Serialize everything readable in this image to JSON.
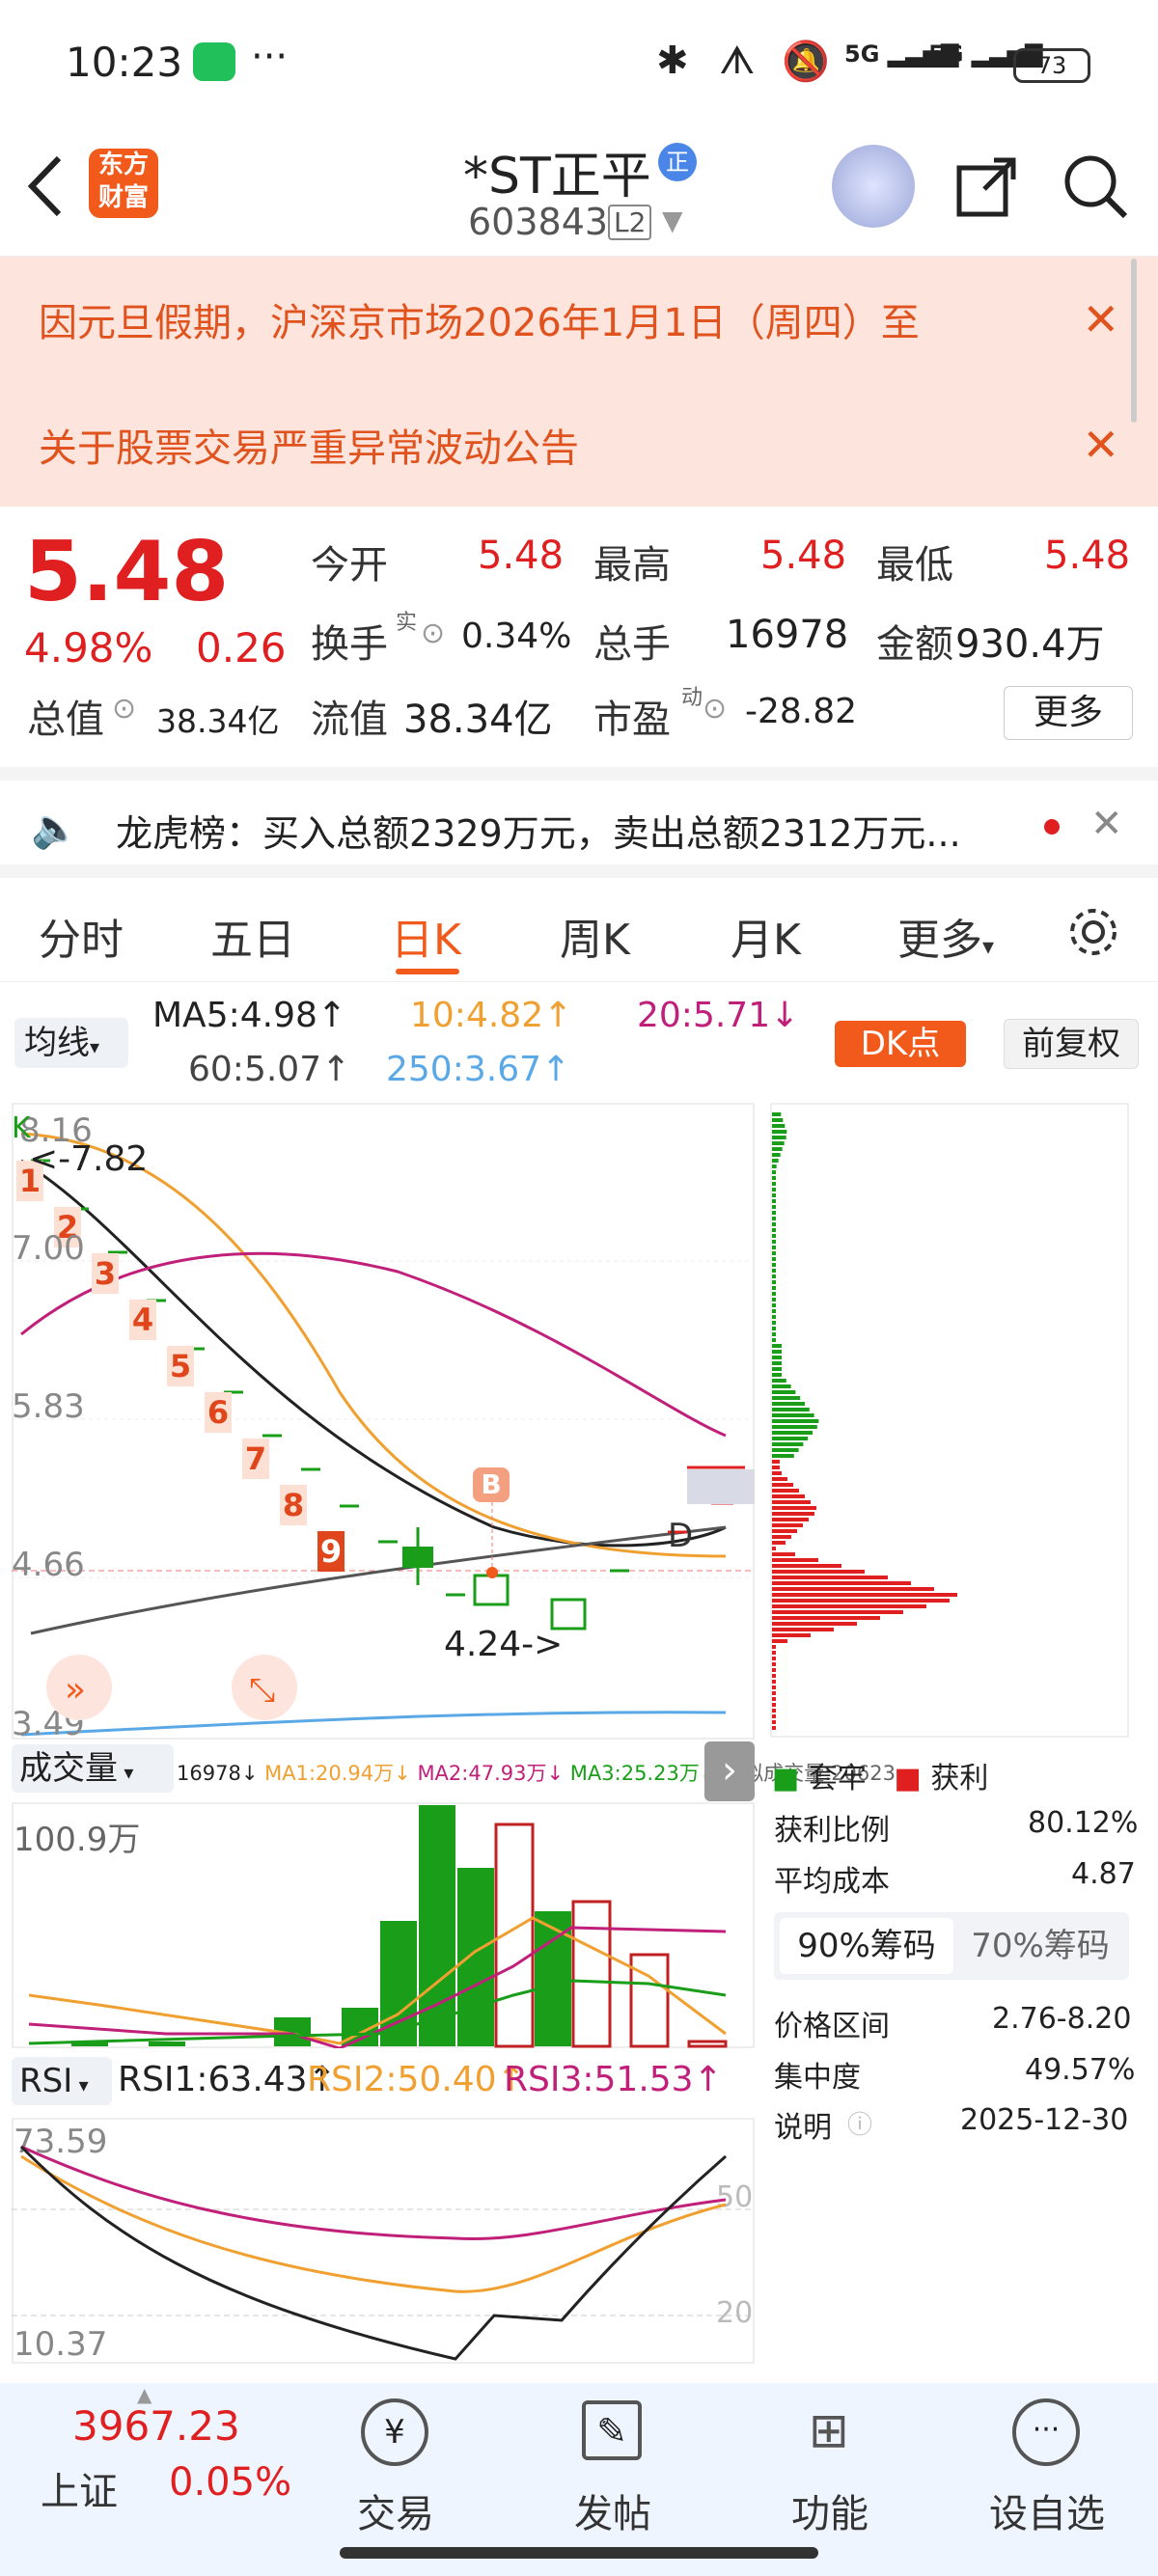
{
  "status": {
    "time": "10:23",
    "dots": "···",
    "net1": "5G",
    "net2": "5G",
    "battery": "73"
  },
  "header": {
    "logo_line1": "东方",
    "logo_line2": "财富",
    "stock_name": "*ST正平",
    "badge": "正",
    "code": "603843",
    "level": "L2"
  },
  "notices": [
    {
      "text": "因元旦假期，沪深京市场2026年1月1日（周四）至"
    },
    {
      "text": "关于股票交易严重异常波动公告"
    }
  ],
  "quote": {
    "price": "5.48",
    "change_pct": "4.98%",
    "change": "0.26",
    "open_label": "今开",
    "open": "5.48",
    "high_label": "最高",
    "high": "5.48",
    "low_label": "最低",
    "low": "5.48",
    "turnover_label": "换手",
    "turnover_sup": "实",
    "turnover": "0.34%",
    "volume_label": "总手",
    "volume": "16978",
    "amount_label": "金额",
    "amount": "930.4万",
    "mktcap_label": "总值",
    "mktcap": "38.34亿",
    "float_label": "流值",
    "float": "38.34亿",
    "pe_label": "市盈",
    "pe_sup": "动",
    "pe": "-28.82",
    "more": "更多"
  },
  "dragon": {
    "text": "龙虎榜：买入总额2329万元，卖出总额2312万元..."
  },
  "tabs": [
    "分时",
    "五日",
    "日K",
    "周K",
    "月K",
    "更多"
  ],
  "ma": {
    "selector": "均线",
    "ma5": "MA5:4.98",
    "ma10": "10:4.82",
    "ma20": "20:5.71",
    "ma60": "60:5.07",
    "ma250": "250:3.67",
    "dk": "DK点",
    "fq": "前复权"
  },
  "kchart": {
    "y_labels": [
      "8.16",
      "7.00",
      "5.83",
      "4.66",
      "3.49"
    ],
    "hi_label": "<-7.82",
    "lo_label": "4.24->",
    "seq": [
      "1",
      "2",
      "3",
      "4",
      "5",
      "6",
      "7",
      "8",
      "9"
    ],
    "b_label": "B",
    "d_label": "D",
    "k_label": "K"
  },
  "vol": {
    "selector": "成交量",
    "v": "16978",
    "ma1": "MA1:20.94万",
    "ma2": "MA2:47.93万",
    "ma3": "MA3:25.23万",
    "virtual": "虚拟成交量:20623",
    "top": "100.9万"
  },
  "rsi": {
    "selector": "RSI",
    "r1": "RSI1:63.43",
    "r2": "RSI2:50.40",
    "r3": "RSI3:51.53",
    "top": "73.59",
    "bottom": "10.37",
    "l50": "50",
    "l20": "20"
  },
  "chips": {
    "legend_trap": "套牢",
    "legend_profit": "获利",
    "profit_ratio_label": "获利比例",
    "profit_ratio": "80.12%",
    "avg_cost_label": "平均成本",
    "avg_cost": "4.87",
    "tab90": "90%筹码",
    "tab70": "70%筹码",
    "range_label": "价格区间",
    "range": "2.76-8.20",
    "conc_label": "集中度",
    "conc": "49.57%",
    "note_label": "说明",
    "date": "2025-12-30"
  },
  "bottom": {
    "index_value": "3967.23",
    "index_name": "上证",
    "index_pct": "0.05%",
    "trade": "交易",
    "post": "发帖",
    "func": "功能",
    "watch": "设自选"
  },
  "colors": {
    "red": "#e02020",
    "green": "#1a9e1a",
    "orange": "#f0a030",
    "magenta": "#c0207a",
    "blue": "#5aa9e6"
  }
}
